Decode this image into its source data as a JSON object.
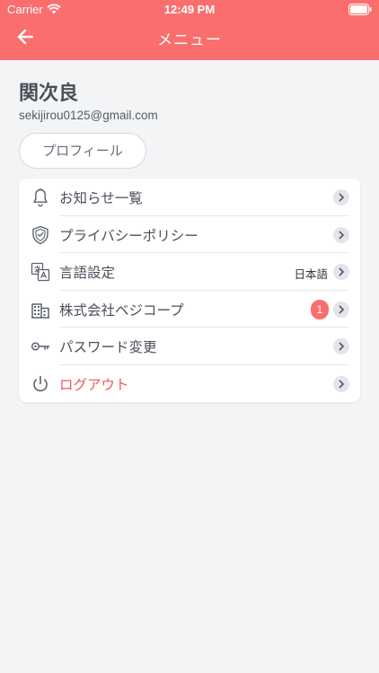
{
  "status_bar": {
    "carrier": "Carrier",
    "time": "12:49 PM"
  },
  "nav": {
    "title": "メニュー",
    "back_icon": "arrow-left-icon"
  },
  "profile": {
    "name": "関次良",
    "email": "sekijirou0125@gmail.com",
    "profile_button": "プロフィール"
  },
  "menu": {
    "items": [
      {
        "label": "お知らせ一覧",
        "icon": "bell-icon"
      },
      {
        "label": "プライバシーポリシー",
        "icon": "shield-icon"
      },
      {
        "label": "言語設定",
        "icon": "translate-icon",
        "value": "日本語"
      },
      {
        "label": "株式会社ベジコープ",
        "icon": "building-icon",
        "badge": "1"
      },
      {
        "label": "パスワード変更",
        "icon": "key-icon"
      },
      {
        "label": "ログアウト",
        "icon": "power-icon"
      }
    ]
  },
  "colors": {
    "accent": "#fa6e6e",
    "logout": "#f2545b",
    "background": "#f3f4f6"
  }
}
